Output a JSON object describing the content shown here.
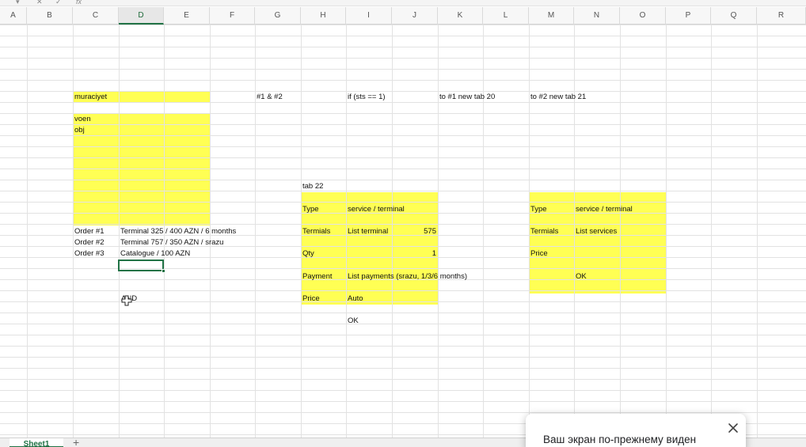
{
  "formula_bar": {
    "dropdown_icon": "chevron-down-icon",
    "cancel_icon": "close-icon",
    "confirm_icon": "check-icon",
    "fx_label": "fx"
  },
  "columns": [
    "A",
    "B",
    "C",
    "D",
    "E",
    "F",
    "G",
    "H",
    "I",
    "J",
    "K",
    "L",
    "M",
    "N",
    "O",
    "P",
    "Q",
    "R"
  ],
  "selected_column": "D",
  "cells": {
    "c9": "muraciyet",
    "g9": "#1 & #2",
    "i9": "if (sts == 1)",
    "k9": "to #1 new tab 20",
    "m9": "to #2 new tab 21",
    "c11": "voen",
    "c12": "obj",
    "h17": "tab 22",
    "h19": "Type",
    "i19": "service / terminal",
    "m19": "Type",
    "n19": "service / terminal",
    "c21": "Order #1",
    "d21": "Terminal 325 / 400 AZN / 6 months",
    "h21": "Termials",
    "i21": "List terminal",
    "j21": "575",
    "m21": "Termials",
    "n21": "List services",
    "c22": "Order #2",
    "d22": "Terminal 757 / 350 AZN / srazu",
    "c23": "Order #3",
    "d23": "Catalogue / 100 AZN",
    "h23": "Qty",
    "j23": "1",
    "m23": "Price",
    "h25": "Payment",
    "i25": "List payments (srazu, 1/3/6 months)",
    "n25": "OK",
    "d27": "AND",
    "h27": "Price",
    "i27": "Auto",
    "i29": "OK"
  },
  "colors": {
    "highlight": "#ffff54",
    "accent": "#217346"
  },
  "sheet_tabs": [
    {
      "label": "Sheet1"
    }
  ],
  "add_sheet_label": "+",
  "toast": {
    "message": "Ваш экран по-прежнему виден"
  }
}
